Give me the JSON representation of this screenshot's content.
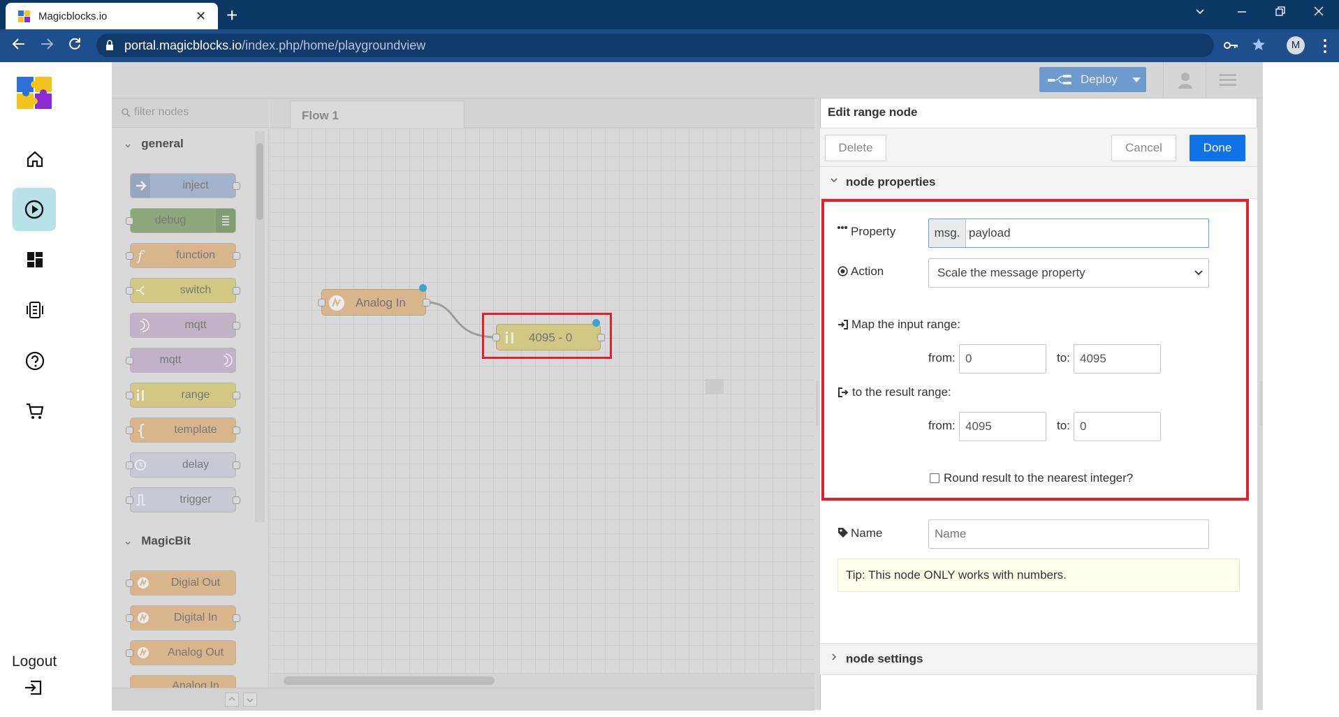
{
  "browser": {
    "tab_title": "Magicblocks.io",
    "tab_close": "✕",
    "new_tab": "+",
    "url_host": "portal.magicblocks.io",
    "url_path": "/index.php/home/playgroundview",
    "profile_initial": "M"
  },
  "app_sidebar": {
    "logout_label": "Logout"
  },
  "header": {
    "deploy_label": "Deploy"
  },
  "palette": {
    "filter_placeholder": "filter nodes",
    "categories": [
      {
        "label": "general",
        "nodes": [
          "inject",
          "debug",
          "function",
          "switch",
          "mqtt",
          "mqtt",
          "range",
          "template",
          "delay",
          "trigger"
        ]
      },
      {
        "label": "MagicBit",
        "nodes": [
          "Digial Out",
          "Digital In",
          "Analog Out",
          "Analog In"
        ]
      }
    ]
  },
  "workspace": {
    "flow_tab": "Flow 1",
    "nodes": [
      {
        "label": "Analog In"
      },
      {
        "label": "4095 - 0"
      }
    ]
  },
  "tray": {
    "title": "Edit range node",
    "delete_label": "Delete",
    "cancel_label": "Cancel",
    "done_label": "Done",
    "section_properties": "node properties",
    "section_settings": "node settings",
    "property_label": "Property",
    "property_prefix": "msg.",
    "property_value": "payload",
    "action_label": "Action",
    "action_value": "Scale the message property",
    "input_range_label": "Map the input range:",
    "result_range_label": "to the result range:",
    "from_label": "from:",
    "to_label": "to:",
    "input_from": "0",
    "input_to": "4095",
    "result_from": "4095",
    "result_to": "0",
    "round_label": "Round result to the nearest integer?",
    "round_checked": false,
    "name_label": "Name",
    "name_placeholder": "Name",
    "tip": "Tip: This node ONLY works with numbers."
  },
  "colors": {
    "highlight": "#e41e2b",
    "done_button": "#0f72e6",
    "deploy_button": "#6e9ad0",
    "browser_titlebar": "#0c3865",
    "browser_toolbar": "#1d4f8d",
    "active_sidebar": "#b8e2ea"
  }
}
